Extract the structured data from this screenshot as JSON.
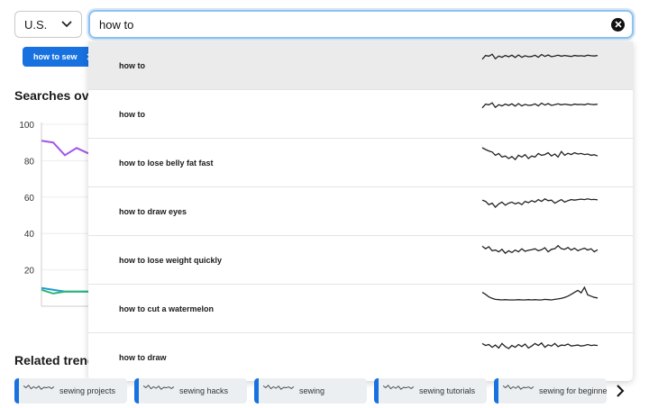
{
  "region": {
    "label": "U.S."
  },
  "search": {
    "value": "how to"
  },
  "chip": {
    "label": "how to sew"
  },
  "headings": {
    "searches": "Searches ove",
    "related": "Related trend"
  },
  "chart": {
    "y_ticks": [
      "100",
      "80",
      "60",
      "40",
      "20"
    ]
  },
  "chart_data": {
    "type": "line",
    "ylim": [
      0,
      100
    ],
    "y_ticks": [
      100,
      80,
      60,
      40,
      20
    ],
    "grid": true,
    "series": [
      {
        "color": "#a355e8",
        "values": [
          91,
          90,
          83,
          87,
          84
        ]
      },
      {
        "color": "#1f9ccf",
        "values": [
          10,
          9,
          8,
          8,
          8
        ]
      },
      {
        "color": "#2bb673",
        "values": [
          9,
          7,
          8,
          8,
          8
        ]
      }
    ]
  },
  "suggestions": [
    {
      "label": "how to",
      "spark": [
        60,
        45,
        48,
        40,
        58,
        47,
        52,
        45,
        50,
        44,
        53,
        43,
        52,
        46,
        50,
        49,
        44,
        52,
        41,
        49,
        43,
        50,
        47,
        44,
        48,
        45,
        47,
        49,
        45,
        47,
        46,
        48,
        44,
        46,
        47,
        45
      ]
    },
    {
      "label": "how to",
      "spark": [
        60,
        45,
        48,
        40,
        58,
        47,
        52,
        45,
        50,
        44,
        53,
        43,
        52,
        46,
        50,
        49,
        44,
        52,
        41,
        49,
        43,
        50,
        47,
        44,
        48,
        45,
        47,
        49,
        45,
        47,
        46,
        48,
        44,
        46,
        47,
        45
      ]
    },
    {
      "label": "how to lose belly fat fast",
      "spark": [
        25,
        32,
        38,
        42,
        55,
        48,
        62,
        58,
        68,
        60,
        72,
        55,
        62,
        52,
        68,
        58,
        62,
        48,
        55,
        52,
        45,
        58,
        50,
        62,
        40,
        55,
        47,
        52,
        45,
        50,
        48,
        52,
        50,
        55,
        53,
        58
      ]
    },
    {
      "label": "how to draw eyes",
      "spark": [
        40,
        45,
        58,
        52,
        68,
        55,
        48,
        60,
        52,
        48,
        55,
        50,
        58,
        45,
        50,
        42,
        48,
        38,
        45,
        35,
        42,
        40,
        52,
        45,
        38,
        48,
        42,
        38,
        40,
        38,
        36,
        38,
        35,
        38,
        37,
        39
      ]
    },
    {
      "label": "how to lose weight quickly",
      "spark": [
        30,
        40,
        32,
        48,
        45,
        52,
        42,
        58,
        48,
        55,
        45,
        52,
        40,
        50,
        46,
        44,
        40,
        48,
        44,
        36,
        52,
        42,
        40,
        28,
        40,
        42,
        35,
        45,
        38,
        48,
        42,
        38,
        45,
        40,
        52,
        44
      ]
    },
    {
      "label": "how to cut a watermelon",
      "spark": [
        20,
        28,
        38,
        44,
        48,
        49,
        50,
        49,
        50,
        50,
        50,
        49,
        50,
        50,
        49,
        50,
        49,
        50,
        50,
        48,
        49,
        50,
        48,
        46,
        44,
        40,
        35,
        28,
        20,
        12,
        22,
        0,
        30,
        35,
        40,
        42
      ]
    },
    {
      "label": "how to draw",
      "spark": [
        30,
        38,
        34,
        45,
        36,
        48,
        30,
        42,
        50,
        38,
        45,
        34,
        42,
        32,
        48,
        40,
        30,
        38,
        28,
        45,
        35,
        40,
        30,
        42,
        36,
        38,
        32,
        40,
        38,
        36,
        40,
        38,
        34,
        38,
        36,
        38
      ]
    }
  ],
  "related": [
    {
      "label": "sewing projects"
    },
    {
      "label": "sewing hacks"
    },
    {
      "label": "sewing"
    },
    {
      "label": "sewing tutorials"
    },
    {
      "label": "sewing for beginners"
    }
  ],
  "icons": {
    "region_caret": "chevron-down-icon",
    "clear": "close-icon",
    "chip_remove": "close-icon",
    "related_next": "chevron-right-icon"
  },
  "colors": {
    "accent": "#1772e0",
    "focus_ring": "#8ec2ee"
  }
}
